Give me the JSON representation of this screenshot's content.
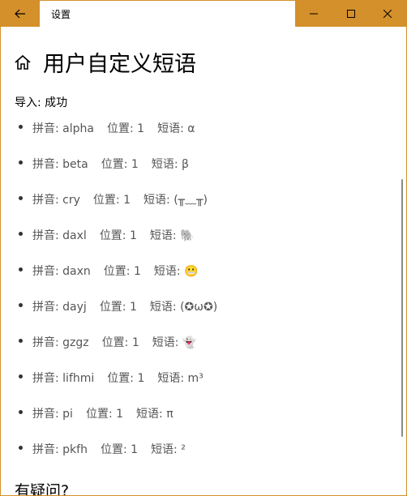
{
  "window": {
    "title": "设置",
    "accent": "#d4902a",
    "back_icon": "arrow-left-icon",
    "controls": [
      "minimize-icon",
      "maximize-icon",
      "close-icon"
    ]
  },
  "page": {
    "title": "用户自定义短语",
    "home_icon": "home-icon",
    "import_status": "导入: 成功",
    "faq_heading": "有疑问?"
  },
  "labels": {
    "pinyin": "拼音:",
    "position": "位置:",
    "phrase": "短语:"
  },
  "phrases": [
    {
      "pinyin": "alpha",
      "position": "1",
      "phrase": "α"
    },
    {
      "pinyin": "beta",
      "position": "1",
      "phrase": "β"
    },
    {
      "pinyin": "cry",
      "position": "1",
      "phrase": "(╥﹏╥)"
    },
    {
      "pinyin": "daxl",
      "position": "1",
      "phrase": "🐘"
    },
    {
      "pinyin": "daxn",
      "position": "1",
      "phrase": "😬"
    },
    {
      "pinyin": "dayj",
      "position": "1",
      "phrase": "(✪ω✪)"
    },
    {
      "pinyin": "gzgz",
      "position": "1",
      "phrase": "👻"
    },
    {
      "pinyin": "lifhmi",
      "position": "1",
      "phrase": "m³"
    },
    {
      "pinyin": "pi",
      "position": "1",
      "phrase": "π"
    },
    {
      "pinyin": "pkfh",
      "position": "1",
      "phrase": "²"
    }
  ]
}
